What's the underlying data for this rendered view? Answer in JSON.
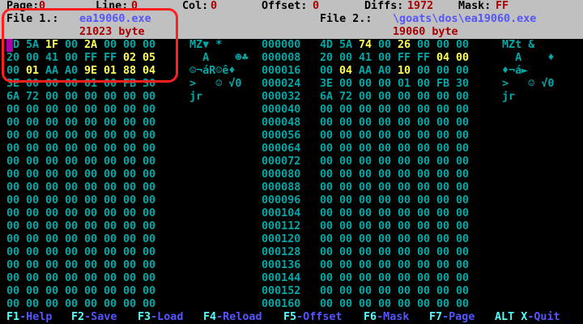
{
  "status": {
    "page_label": "Page:",
    "page_value": "0",
    "line_label": "Line:",
    "line_value": "0",
    "col_label": "Col:",
    "col_value": "0",
    "offset_label": "Offset:",
    "offset_value": "0",
    "diffs_label": "Diffs:",
    "diffs_value": "1972",
    "mask_label": "Mask:",
    "mask_value": "FF"
  },
  "file1": {
    "label": "File 1.:",
    "name": "ea19060.exe",
    "size": "21023 byte"
  },
  "file2": {
    "label": "File 2.:",
    "name": "\\goats\\dos\\ea19060.exe",
    "size": "19060 byte"
  },
  "offsets": [
    "000000",
    "000008",
    "000016",
    "000024",
    "000032",
    "000040",
    "000048",
    "000056",
    "000064",
    "000072",
    "000080",
    "000088",
    "000096",
    "000104",
    "000112",
    "000120",
    "000128",
    "000136",
    "000144",
    "000152",
    "000160"
  ],
  "left_rows": [
    {
      "bytes": [
        "4D",
        "5A",
        "1F",
        "00",
        "2A",
        "00",
        "00",
        "00"
      ],
      "hl": [
        2,
        4
      ],
      "ascii": "MZ▼ *"
    },
    {
      "bytes": [
        "20",
        "00",
        "41",
        "00",
        "FF",
        "FF",
        "02",
        "05"
      ],
      "hl": [
        6,
        7
      ],
      "ascii": "  A    ☻♣"
    },
    {
      "bytes": [
        "00",
        "01",
        "AA",
        "A0",
        "9E",
        "01",
        "88",
        "04"
      ],
      "hl": [
        1,
        4,
        5,
        6,
        7
      ],
      "ascii": "☺¬áR☺ê♦"
    },
    {
      "bytes": [
        "3E",
        "00",
        "00",
        "00",
        "01",
        "00",
        "FB",
        "30"
      ],
      "hl": [],
      "ascii": ">   ☺ √0"
    },
    {
      "bytes": [
        "6A",
        "72",
        "00",
        "00",
        "00",
        "00",
        "00",
        "00"
      ],
      "hl": [],
      "ascii": "jr"
    }
  ],
  "right_rows": [
    {
      "bytes": [
        "4D",
        "5A",
        "74",
        "00",
        "26",
        "00",
        "00",
        "00"
      ],
      "hl": [
        2,
        4
      ],
      "ascii": "MZt &"
    },
    {
      "bytes": [
        "20",
        "00",
        "41",
        "00",
        "FF",
        "FF",
        "04",
        "00"
      ],
      "hl": [
        6,
        7
      ],
      "ascii": "  A    ♦"
    },
    {
      "bytes": [
        "00",
        "04",
        "AA",
        "A0",
        "10",
        "00",
        "00",
        "00"
      ],
      "hl": [
        1,
        4
      ],
      "ascii": "♦¬á►"
    },
    {
      "bytes": [
        "3E",
        "00",
        "00",
        "00",
        "01",
        "00",
        "FB",
        "30"
      ],
      "hl": [],
      "ascii": ">   ☺ √0"
    },
    {
      "bytes": [
        "6A",
        "72",
        "00",
        "00",
        "00",
        "00",
        "00",
        "00"
      ],
      "hl": [],
      "ascii": "jr"
    }
  ],
  "empty_byte": "00",
  "footer": [
    {
      "key": "F1",
      "label": "-Help"
    },
    {
      "key": "F2",
      "label": "-Save"
    },
    {
      "key": "F3",
      "label": "-Load"
    },
    {
      "key": "F4",
      "label": "-Reload"
    },
    {
      "key": "F5",
      "label": "-Offset"
    },
    {
      "key": "F6",
      "label": "-Mask"
    },
    {
      "key": "F7",
      "label": "-Page"
    },
    {
      "key": "ALT X",
      "label": "-Quit"
    }
  ]
}
